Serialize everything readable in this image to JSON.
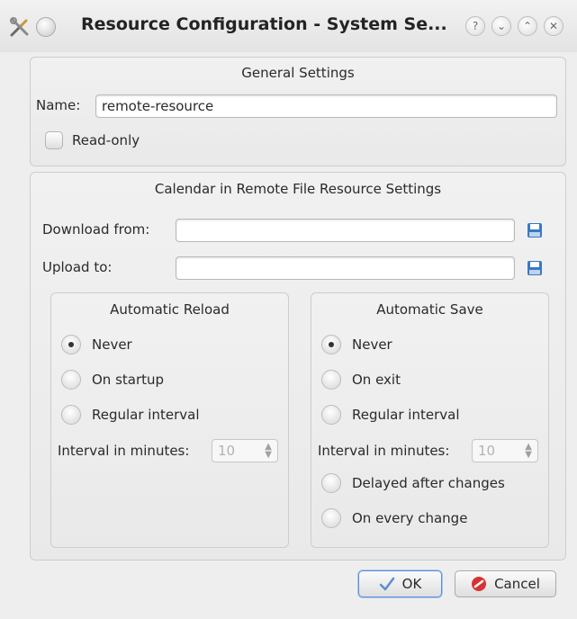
{
  "window": {
    "title": "Resource Configuration - System Se...",
    "buttons": {
      "help": "?",
      "minimize": "⌄",
      "maximize": "⌃",
      "close": "✕"
    }
  },
  "general": {
    "title": "General Settings",
    "name_label": "Name:",
    "name_value": "remote-resource",
    "readonly_label": "Read-only",
    "readonly_checked": false
  },
  "remote": {
    "title": "Calendar in Remote File Resource Settings",
    "download_label": "Download from:",
    "download_value": "",
    "upload_label": "Upload to:",
    "upload_value": "",
    "reload": {
      "title": "Automatic Reload",
      "options": [
        {
          "label": "Never",
          "selected": true
        },
        {
          "label": "On startup",
          "selected": false
        },
        {
          "label": "Regular interval",
          "selected": false
        }
      ],
      "interval_label": "Interval in minutes:",
      "interval_value": "10"
    },
    "save": {
      "title": "Automatic Save",
      "options": [
        {
          "label": "Never",
          "selected": true
        },
        {
          "label": "On exit",
          "selected": false
        },
        {
          "label": "Regular interval",
          "selected": false
        }
      ],
      "interval_label": "Interval in minutes:",
      "interval_value": "10",
      "extra_options": [
        {
          "label": "Delayed after changes",
          "selected": false
        },
        {
          "label": "On every change",
          "selected": false
        }
      ]
    }
  },
  "buttons": {
    "ok": "OK",
    "cancel": "Cancel"
  },
  "colors": {
    "accent": "#5b8fd0",
    "save_icon": "#3a78c4",
    "cancel_icon": "#d83232"
  }
}
